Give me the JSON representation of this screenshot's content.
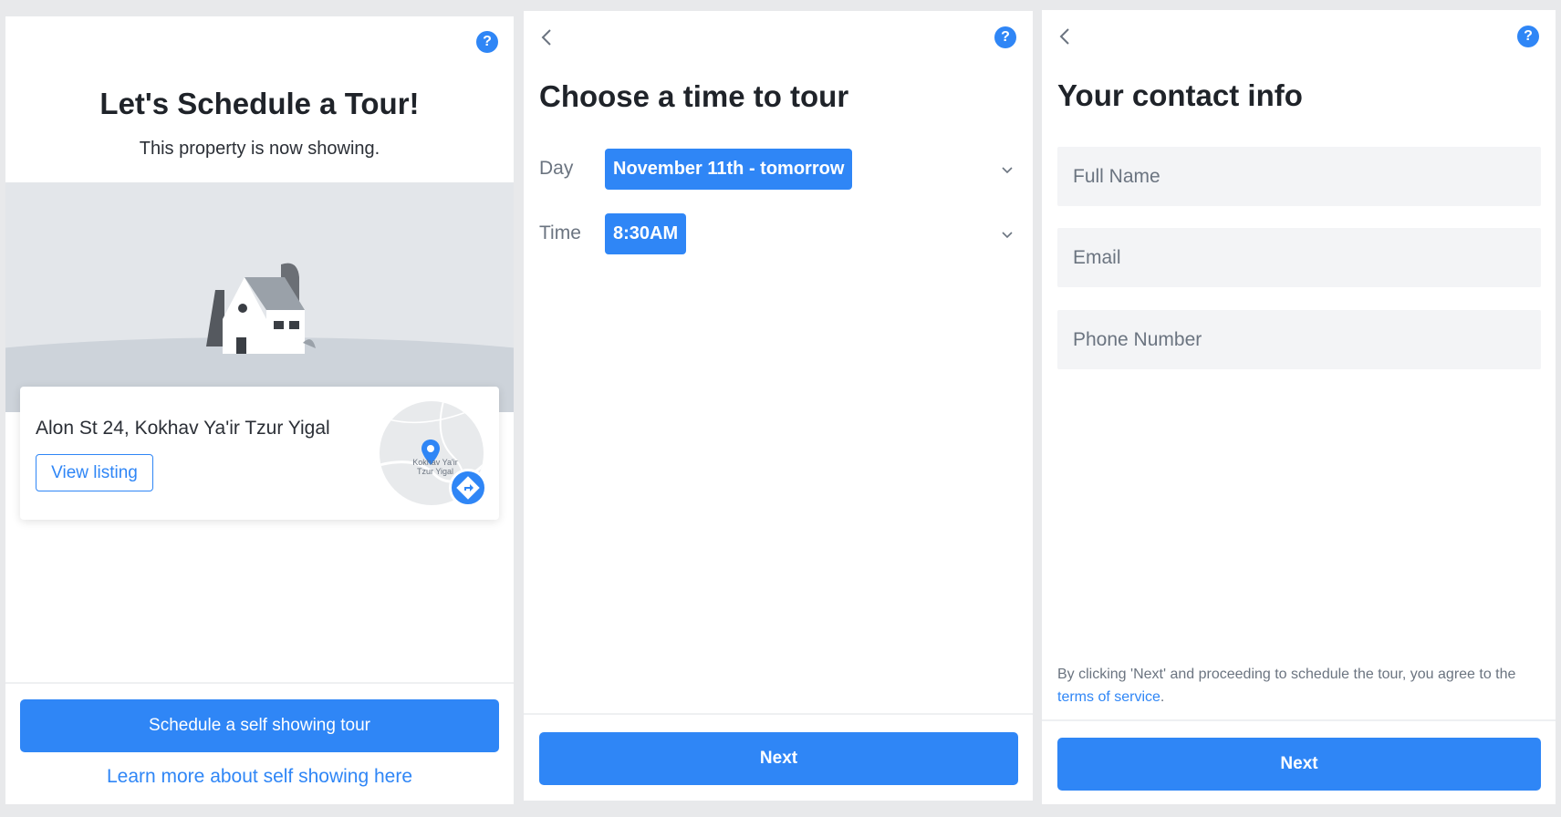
{
  "panel1": {
    "title": "Let's Schedule a Tour!",
    "subtitle": "This property is now showing.",
    "address": "Alon St 24, Kokhav Ya'ir Tzur Yigal",
    "view_listing_label": "View listing",
    "map_label": "Kokhav Ya'ir Tzur Yigal",
    "schedule_button_label": "Schedule a self showing tour",
    "learn_more_label": "Learn more about self showing here",
    "help_icon": "?"
  },
  "panel2": {
    "title": "Choose a time to tour",
    "day_label": "Day",
    "day_value": "November 11th - tomorrow",
    "time_label": "Time",
    "time_value": "8:30AM",
    "next_label": "Next",
    "help_icon": "?"
  },
  "panel3": {
    "title": "Your contact info",
    "full_name_placeholder": "Full Name",
    "email_placeholder": "Email",
    "phone_placeholder": "Phone Number",
    "terms_prefix": "By clicking 'Next' and proceeding to schedule the tour, you agree to the ",
    "terms_link": "terms of service",
    "terms_suffix": ".",
    "next_label": "Next",
    "help_icon": "?"
  },
  "colors": {
    "accent": "#2f86f6",
    "background": "#e8e9eb",
    "muted_text": "#6b7480"
  }
}
